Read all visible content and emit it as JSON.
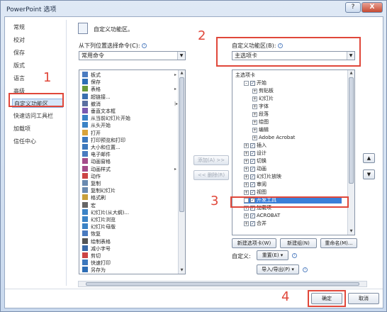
{
  "window": {
    "title": "PowerPoint 选项",
    "help": "?",
    "close": "X"
  },
  "nav": {
    "items": [
      "常规",
      "校对",
      "保存",
      "版式",
      "语言",
      "高级",
      "自定义功能区",
      "快速访问工具栏",
      "加载项",
      "信任中心"
    ],
    "selected": 6
  },
  "header": {
    "title": "自定义功能区。"
  },
  "left": {
    "label": "从下列位置选择命令(C):",
    "combo_value": "常用命令",
    "commands": [
      {
        "label": "板式",
        "sub": "▸"
      },
      {
        "label": "保存",
        "sub": ""
      },
      {
        "label": "表格",
        "sub": "▸"
      },
      {
        "label": "超链接...",
        "sub": ""
      },
      {
        "label": "撤消",
        "sub": "|▸"
      },
      {
        "label": "垂直文本框",
        "sub": ""
      },
      {
        "label": "从当前幻灯片开始",
        "sub": ""
      },
      {
        "label": "从头开始",
        "sub": ""
      },
      {
        "label": "打开",
        "sub": ""
      },
      {
        "label": "打印预览和打印",
        "sub": ""
      },
      {
        "label": "大小和位置...",
        "sub": ""
      },
      {
        "label": "电子邮件",
        "sub": ""
      },
      {
        "label": "动画窗格",
        "sub": ""
      },
      {
        "label": "动画样式",
        "sub": "▸"
      },
      {
        "label": "动作",
        "sub": ""
      },
      {
        "label": "复制",
        "sub": ""
      },
      {
        "label": "复制幻灯片",
        "sub": ""
      },
      {
        "label": "格式刷",
        "sub": ""
      },
      {
        "label": "宏",
        "sub": ""
      },
      {
        "label": "幻灯片(从大纲)...",
        "sub": ""
      },
      {
        "label": "幻灯片浏览",
        "sub": ""
      },
      {
        "label": "幻灯片母版",
        "sub": ""
      },
      {
        "label": "恢复",
        "sub": ""
      },
      {
        "label": "绘制表格",
        "sub": ""
      },
      {
        "label": "减小字号",
        "sub": ""
      },
      {
        "label": "剪切",
        "sub": ""
      },
      {
        "label": "快速打印",
        "sub": ""
      },
      {
        "label": "另存为",
        "sub": ""
      }
    ]
  },
  "middle": {
    "add": "添加(A) >>",
    "remove": "<< 删除(R)"
  },
  "right": {
    "label": "自定义功能区(B):",
    "combo_value": "主选项卡",
    "tree": [
      {
        "text": "主选项卡",
        "lvl": 0,
        "exp": "",
        "chk": false
      },
      {
        "text": "开始",
        "lvl": 1,
        "exp": "□",
        "chk": true
      },
      {
        "text": "剪贴板",
        "lvl": 2,
        "exp": "⊞",
        "chk": false
      },
      {
        "text": "幻灯片",
        "lvl": 2,
        "exp": "⊞",
        "chk": false
      },
      {
        "text": "字体",
        "lvl": 2,
        "exp": "⊞",
        "chk": false
      },
      {
        "text": "段落",
        "lvl": 2,
        "exp": "⊞",
        "chk": false
      },
      {
        "text": "绘图",
        "lvl": 2,
        "exp": "⊞",
        "chk": false
      },
      {
        "text": "编辑",
        "lvl": 2,
        "exp": "⊞",
        "chk": false
      },
      {
        "text": "Adobe Acrobat",
        "lvl": 2,
        "exp": "⊞",
        "chk": false
      },
      {
        "text": "插入",
        "lvl": 1,
        "exp": "⊞",
        "chk": true
      },
      {
        "text": "设计",
        "lvl": 1,
        "exp": "⊞",
        "chk": true
      },
      {
        "text": "切换",
        "lvl": 1,
        "exp": "⊞",
        "chk": true
      },
      {
        "text": "动画",
        "lvl": 1,
        "exp": "⊞",
        "chk": true
      },
      {
        "text": "幻灯片放映",
        "lvl": 1,
        "exp": "⊞",
        "chk": true
      },
      {
        "text": "审阅",
        "lvl": 1,
        "exp": "⊞",
        "chk": true
      },
      {
        "text": "视图",
        "lvl": 1,
        "exp": "⊞",
        "chk": true
      },
      {
        "text": "开发工具",
        "lvl": 1,
        "exp": "⊞",
        "chk": true,
        "sel": true
      },
      {
        "text": "加载项",
        "lvl": 1,
        "exp": "⊞",
        "chk": true
      },
      {
        "text": "ACROBAT",
        "lvl": 1,
        "exp": "⊞",
        "chk": true
      },
      {
        "text": "合并",
        "lvl": 1,
        "exp": "⊞",
        "chk": true
      }
    ],
    "new_tab": "新建选项卡(W)",
    "new_group": "新建组(N)",
    "rename": "重命名(M)...",
    "custom_label": "自定义:",
    "reset": "重置(E) ▾",
    "import_export": "导入/导出(P) ▾"
  },
  "footer": {
    "ok": "确定",
    "cancel": "取消"
  },
  "annotations": [
    "1",
    "2",
    "3",
    "4"
  ],
  "colors": {
    "annotation": "#e0473a",
    "selection": "#3b7fd8"
  }
}
